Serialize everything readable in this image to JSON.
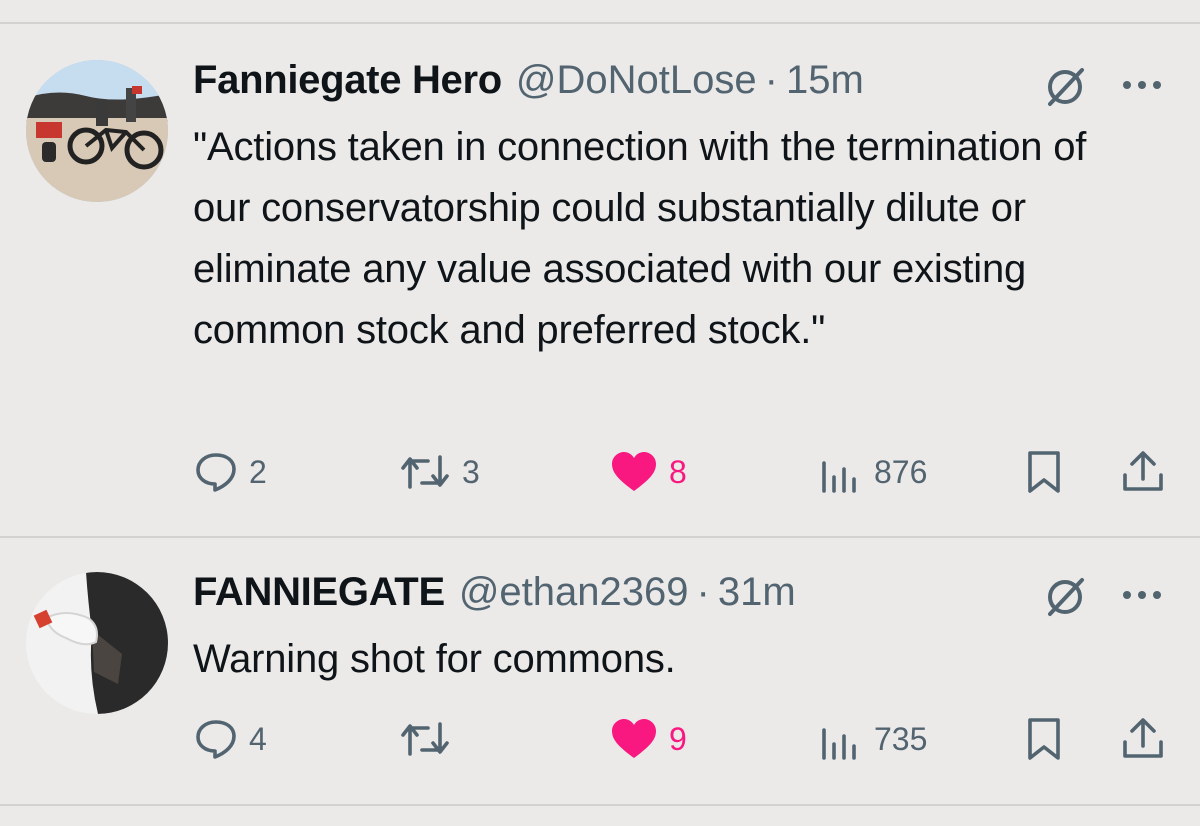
{
  "tweets": [
    {
      "author_name": "Fanniegate Hero",
      "handle": "@DoNotLose",
      "separator": "·",
      "time": "15m",
      "text": "\"Actions taken in connection with the termination of our conservatorship could substantially dilute or eliminate any value associated with our existing common stock and preferred stock.\"",
      "replies": "2",
      "retweets": "3",
      "likes": "8",
      "views": "876",
      "liked": true
    },
    {
      "author_name": "FANNIEGATE",
      "handle": "@ethan2369",
      "separator": "·",
      "time": "31m",
      "text": "Warning shot for commons.",
      "replies": "4",
      "retweets": "",
      "likes": "9",
      "views": "735",
      "liked": true
    }
  ],
  "icons": {
    "reply": "reply-icon",
    "retweet": "retweet-icon",
    "like": "heart-icon",
    "views": "views-icon",
    "bookmark": "bookmark-icon",
    "share": "share-icon",
    "grok": "grok-icon",
    "more": "more-icon"
  },
  "colors": {
    "background": "#ebeae9",
    "text": "#0f1419",
    "muted": "#536471",
    "like": "#f91880",
    "divider": "#d3d2d1"
  }
}
